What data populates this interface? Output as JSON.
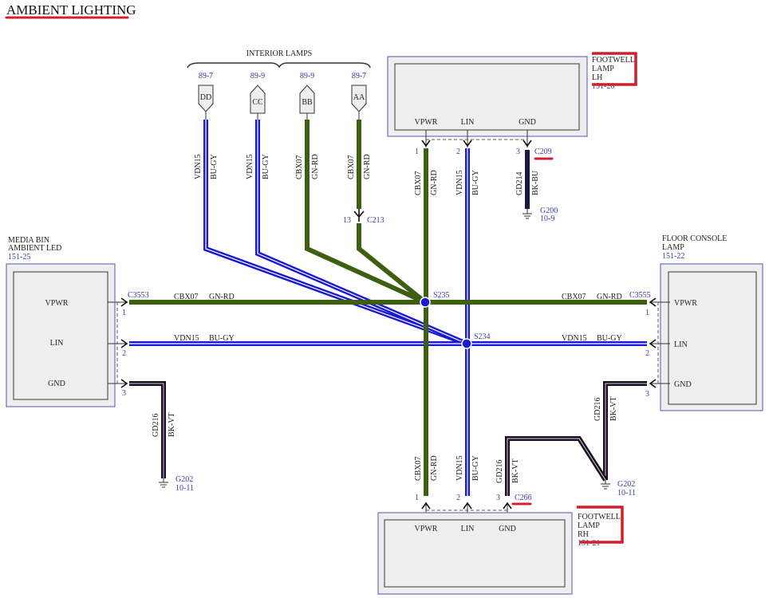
{
  "title": "AMBIENT LIGHTING",
  "colors": {
    "green_wire": "#3f5f10",
    "blue_wire": "#1a1ad0",
    "black_wire": "#1a1020",
    "ref_text": "#3a3aa8",
    "annotation": "#d0202c",
    "module_fill": "#eeeeee",
    "module_border": "#7070c0"
  },
  "interior_lamps": {
    "label": "INTERIOR LAMPS",
    "connectors": [
      {
        "id": "DD",
        "ref": "89-7",
        "circuit": "VDN15",
        "color": "BU-GY"
      },
      {
        "id": "CC",
        "ref": "89-9",
        "circuit": "VDN15",
        "color": "BU-GY"
      },
      {
        "id": "BB",
        "ref": "89-9",
        "circuit": "CBX07",
        "color": "GN-RD"
      },
      {
        "id": "AA",
        "ref": "89-7",
        "circuit": "CBX07",
        "color": "GN-RD"
      }
    ],
    "inline_connector": {
      "pin": "13",
      "id": "C213"
    }
  },
  "footwell_lh": {
    "name_lines": [
      "FOOTWELL",
      "LAMP",
      "LH"
    ],
    "ref": "151-20",
    "connector": "C209",
    "pins": [
      {
        "label": "VPWR",
        "num": "1",
        "circuit": "CBX07",
        "color": "GN-RD"
      },
      {
        "label": "LIN",
        "num": "2",
        "circuit": "VDN15",
        "color": "BU-GY"
      },
      {
        "label": "GND",
        "num": "3",
        "circuit": "GD214",
        "color": "BK-BU"
      }
    ],
    "ground": {
      "id": "G200",
      "ref": "10-9"
    }
  },
  "media_bin": {
    "name_lines": [
      "MEDIA BIN",
      "AMBIENT LED"
    ],
    "ref": "151-25",
    "connector": "C3553",
    "pins": [
      {
        "label": "VPWR",
        "num": "1",
        "circuit": "CBX07",
        "color": "GN-RD"
      },
      {
        "label": "LIN",
        "num": "2",
        "circuit": "VDN15",
        "color": "BU-GY"
      },
      {
        "label": "GND",
        "num": "3",
        "circuit": "GD216",
        "color": "BK-VT"
      }
    ],
    "ground": {
      "id": "G202",
      "ref": "10-11"
    }
  },
  "floor_console": {
    "name_lines": [
      "FLOOR CONSOLE",
      "LAMP"
    ],
    "ref": "151-22",
    "connector": "C3555",
    "pins": [
      {
        "label": "VPWR",
        "num": "1",
        "circuit": "CBX07",
        "color": "GN-RD"
      },
      {
        "label": "LIN",
        "num": "2",
        "circuit": "VDN15",
        "color": "BU-GY"
      },
      {
        "label": "GND",
        "num": "3",
        "circuit": "GD216",
        "color": "BK-VT"
      }
    ],
    "ground": {
      "id": "G202",
      "ref": "10-11"
    }
  },
  "footwell_rh": {
    "name_lines": [
      "FOOTWELL",
      "LAMP",
      "RH"
    ],
    "ref": "151-21",
    "connector": "C266",
    "pins": [
      {
        "label": "VPWR",
        "num": "1",
        "circuit": "CBX07",
        "color": "GN-RD"
      },
      {
        "label": "LIN",
        "num": "2",
        "circuit": "VDN15",
        "color": "BU-GY"
      },
      {
        "label": "GND",
        "num": "3",
        "circuit": "GD216",
        "color": "BK-VT"
      }
    ]
  },
  "splices": {
    "green": "S235",
    "blue": "S234"
  }
}
